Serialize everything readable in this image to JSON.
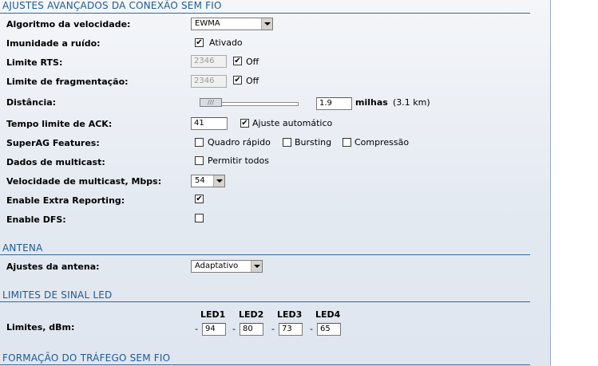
{
  "sections": {
    "wireless_advanced": "AJUSTES AVANÇADOS DA CONEXÃO SEM FIO",
    "antenna": "ANTENA",
    "led_limits": "LIMITES DE SINAL LED",
    "traffic_shaping": "FORMAÇÃO DO TRÁFEGO SEM FIO"
  },
  "rate_algorithm": {
    "label": "Algoritmo da velocidade:",
    "value": "EWMA"
  },
  "noise_immunity": {
    "label": "Imunidade a ruído:",
    "checked": true,
    "option": "Ativado"
  },
  "rts_threshold": {
    "label": "Limite RTS:",
    "value": "2346",
    "off_checked": true,
    "off_label": "Off"
  },
  "fragmentation": {
    "label": "Limite de fragmentação:",
    "value": "2346",
    "off_checked": true,
    "off_label": "Off"
  },
  "distance": {
    "label": "Distância:",
    "slider_icon": "slider-handle-icon",
    "value": "1.9",
    "unit": "milhas",
    "km": "(3.1 km)"
  },
  "ack_timeout": {
    "label": "Tempo limite de ACK:",
    "value": "41",
    "auto_checked": true,
    "auto_label": "Ajuste automático"
  },
  "superag": {
    "label": "SuperAG Features:",
    "options": [
      {
        "label": "Quadro rápido",
        "checked": false
      },
      {
        "label": "Bursting",
        "checked": false
      },
      {
        "label": "Compressão",
        "checked": false
      }
    ]
  },
  "multicast_data": {
    "label": "Dados de multicast:",
    "option": "Permitir todos",
    "checked": false
  },
  "multicast_rate": {
    "label": "Velocidade de multicast, Mbps:",
    "value": "54"
  },
  "extra_reporting": {
    "label": "Enable Extra Reporting:",
    "checked": true
  },
  "dfs": {
    "label": "Enable DFS:",
    "checked": false
  },
  "antenna_settings": {
    "label": "Ajustes da antena:",
    "value": "Adaptativo"
  },
  "leds": {
    "label": "Limites, dBm:",
    "headers": [
      "LED1",
      "LED2",
      "LED3",
      "LED4"
    ],
    "prefix": "-",
    "values": [
      "94",
      "80",
      "73",
      "65"
    ]
  },
  "check_mark": "✔",
  "colors": {
    "section_text": "#1f5a91",
    "section_rule": "#2d6aa6"
  }
}
